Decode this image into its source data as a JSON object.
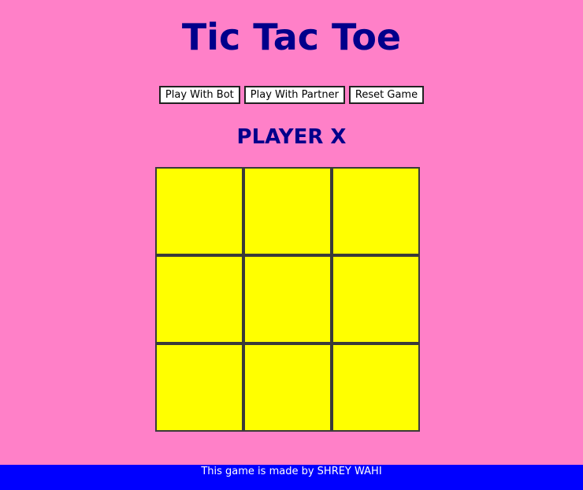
{
  "header": {
    "title": "Tic Tac Toe"
  },
  "controls": {
    "play_bot_label": "Play With Bot",
    "play_partner_label": "Play With Partner",
    "reset_label": "Reset Game"
  },
  "status": {
    "text": "PLAYER X"
  },
  "board": {
    "cells": [
      "",
      "",
      "",
      "",
      "",
      "",
      "",
      "",
      ""
    ]
  },
  "footer": {
    "text": "This game is made by SHREY WAHI"
  },
  "colors": {
    "background": "#ff80c8",
    "title": "#00008b",
    "cell": "#ffff00",
    "footer": "#0000ff"
  }
}
